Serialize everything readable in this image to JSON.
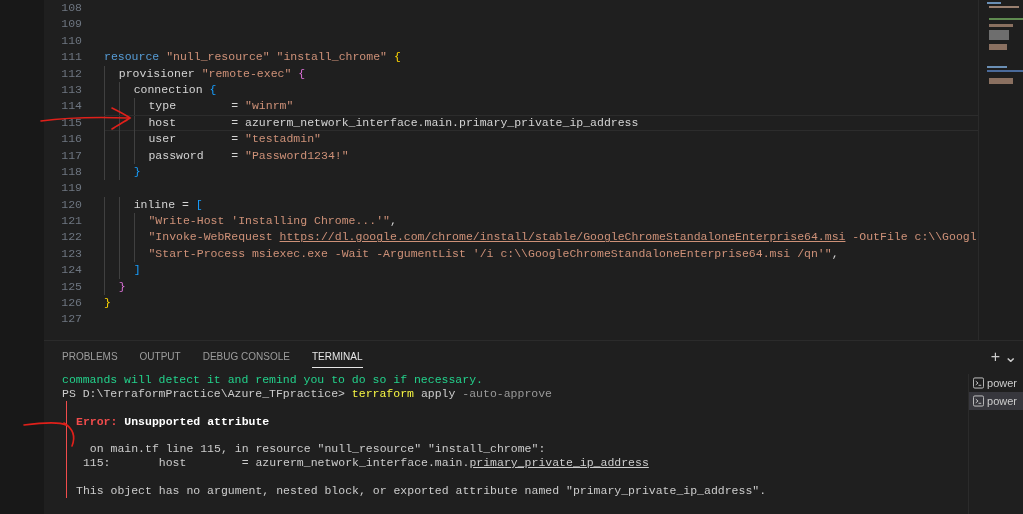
{
  "editor": {
    "lines": [
      {
        "number": "108",
        "current": false
      },
      {
        "number": "109",
        "current": false
      },
      {
        "number": "110",
        "current": false
      },
      {
        "number": "111",
        "current": false,
        "tokens": [
          {
            "text": "resource ",
            "kind": "keyword"
          },
          {
            "text": "\"null_resource\" ",
            "kind": "string"
          },
          {
            "text": "\"install_chrome\" ",
            "kind": "string"
          },
          {
            "text": "{",
            "kind": "bracket1"
          }
        ]
      },
      {
        "number": "112",
        "current": false,
        "tokens": [
          {
            "text": "  provisioner ",
            "kind": "plain"
          },
          {
            "text": "\"remote-exec\" ",
            "kind": "string"
          },
          {
            "text": "{",
            "kind": "bracket2"
          }
        ]
      },
      {
        "number": "113",
        "current": false,
        "tokens": [
          {
            "text": "    connection ",
            "kind": "plain"
          },
          {
            "text": "{",
            "kind": "bracket3"
          }
        ]
      },
      {
        "number": "114",
        "current": false,
        "tokens": [
          {
            "text": "      type        = ",
            "kind": "plain"
          },
          {
            "text": "\"winrm\"",
            "kind": "string"
          }
        ]
      },
      {
        "number": "115",
        "current": true,
        "tokens": [
          {
            "text": "      host        = azurerm_network_interface.main.primary_private_ip_address",
            "kind": "plain"
          }
        ]
      },
      {
        "number": "116",
        "current": false,
        "tokens": [
          {
            "text": "      user        = ",
            "kind": "plain"
          },
          {
            "text": "\"testadmin\"",
            "kind": "string"
          }
        ]
      },
      {
        "number": "117",
        "current": false,
        "tokens": [
          {
            "text": "      password    = ",
            "kind": "plain"
          },
          {
            "text": "\"Password1234!\"",
            "kind": "string"
          }
        ]
      },
      {
        "number": "118",
        "current": false,
        "tokens": [
          {
            "text": "    }",
            "kind": "bracket3"
          }
        ]
      },
      {
        "number": "119",
        "current": false
      },
      {
        "number": "120",
        "current": false,
        "tokens": [
          {
            "text": "    inline = ",
            "kind": "plain"
          },
          {
            "text": "[",
            "kind": "bracket3"
          }
        ]
      },
      {
        "number": "121",
        "current": false,
        "tokens": [
          {
            "text": "      \"Write-Host 'Installing Chrome...'\"",
            "kind": "string"
          },
          {
            "text": ",",
            "kind": "plain"
          }
        ]
      },
      {
        "number": "122",
        "current": false,
        "tokens": [
          {
            "text": "      \"Invoke-WebRequest ",
            "kind": "string"
          },
          {
            "text": "https://dl.google.com/chrome/install/stable/GoogleChromeStandaloneEnterprise64.msi",
            "kind": "link"
          },
          {
            "text": " -OutFile c:\\\\Googl",
            "kind": "string"
          }
        ]
      },
      {
        "number": "123",
        "current": false,
        "tokens": [
          {
            "text": "      \"Start-Process msiexec.exe -Wait -ArgumentList '/i c:\\\\GoogleChromeStandaloneEnterprise64.msi /qn'\"",
            "kind": "string"
          },
          {
            "text": ",",
            "kind": "plain"
          }
        ]
      },
      {
        "number": "124",
        "current": false,
        "tokens": [
          {
            "text": "    ]",
            "kind": "bracket3"
          }
        ]
      },
      {
        "number": "125",
        "current": false,
        "tokens": [
          {
            "text": "  }",
            "kind": "bracket2"
          }
        ]
      },
      {
        "number": "126",
        "current": false,
        "tokens": [
          {
            "text": "}",
            "kind": "bracket1"
          }
        ]
      },
      {
        "number": "127",
        "current": false
      }
    ]
  },
  "panel": {
    "tabs": [
      {
        "label": "PROBLEMS",
        "selected": false
      },
      {
        "label": "OUTPUT",
        "selected": false
      },
      {
        "label": "DEBUG CONSOLE",
        "selected": false
      },
      {
        "label": "TERMINAL",
        "selected": true
      }
    ],
    "actions": [
      "+",
      "⌄"
    ],
    "terminal": {
      "lines": [
        {
          "boxed": false,
          "tokens": [
            {
              "text": "commands will detect it and remind you to do so if necessary.",
              "kind": "green"
            }
          ]
        },
        {
          "boxed": false,
          "tokens": [
            {
              "text": "PS D:\\TerraformPractice\\Azure_TFpractice> ",
              "kind": "plain"
            },
            {
              "text": "terraform",
              "kind": "command"
            },
            {
              "text": " apply ",
              "kind": "plain"
            },
            {
              "text": "-auto-approve",
              "kind": "dim"
            }
          ]
        },
        {
          "boxed": true
        },
        {
          "boxed": true,
          "tokens": [
            {
              "text": "Error: ",
              "kind": "error"
            },
            {
              "text": "Unsupported attribute",
              "kind": "bold"
            }
          ]
        },
        {
          "boxed": true
        },
        {
          "boxed": true,
          "tokens": [
            {
              "text": "  on main.tf line 115, in resource \"null_resource\" \"install_chrome\":",
              "kind": "plain"
            }
          ]
        },
        {
          "boxed": true,
          "tokens": [
            {
              "text": " 115:       host        = azurerm_network_interface.main.",
              "kind": "plain"
            },
            {
              "text": "primary_private_ip_address",
              "kind": "underline"
            }
          ]
        },
        {
          "boxed": true
        },
        {
          "boxed": true,
          "tokens": [
            {
              "text": "This object has no argument, nested block, or exported attribute named \"primary_private_ip_address\".",
              "kind": "plain"
            }
          ]
        }
      ]
    },
    "terminal_list": [
      {
        "label": "power",
        "selected": false
      },
      {
        "label": "power",
        "selected": true
      }
    ]
  }
}
